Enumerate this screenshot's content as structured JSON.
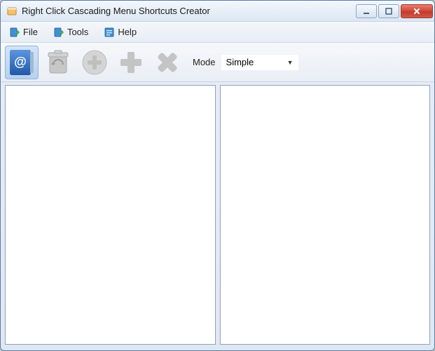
{
  "window": {
    "title": "Right Click Cascading Menu Shortcuts Creator"
  },
  "menubar": {
    "file": "File",
    "tools": "Tools",
    "help": "Help"
  },
  "toolbar": {
    "mode_label": "Mode",
    "mode_value": "Simple"
  }
}
